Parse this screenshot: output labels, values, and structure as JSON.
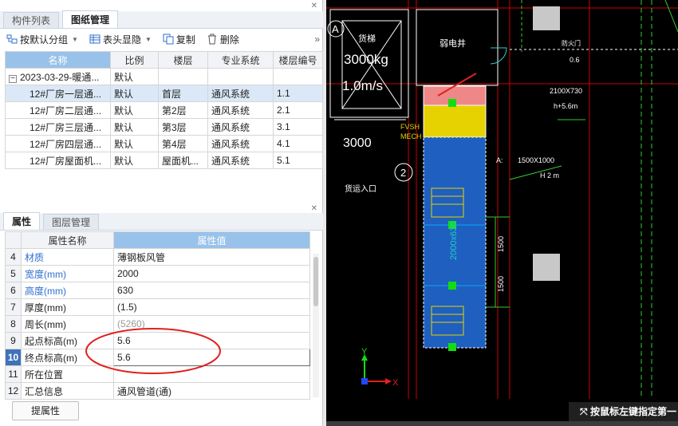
{
  "top_tabs": [
    "构件列表",
    "图纸管理"
  ],
  "toolbar": {
    "group_label": "按默认分组",
    "header_label": "表头显隐",
    "copy_label": "复制",
    "delete_label": "删除",
    "more": "»"
  },
  "drawings_table": {
    "headers": [
      "名称",
      "比例",
      "楼层",
      "专业系统",
      "楼层编号"
    ],
    "group": {
      "expander": "−",
      "name": "2023-03-29-暖通...",
      "scale": "默认"
    },
    "rows": [
      {
        "name": "12#厂房一层通...",
        "scale": "默认",
        "floor": "首层",
        "system": "通风系统",
        "code": "1.1"
      },
      {
        "name": "12#厂房二层通...",
        "scale": "默认",
        "floor": "第2层",
        "system": "通风系统",
        "code": "2.1"
      },
      {
        "name": "12#厂房三层通...",
        "scale": "默认",
        "floor": "第3层",
        "system": "通风系统",
        "code": "3.1"
      },
      {
        "name": "12#厂房四层通...",
        "scale": "默认",
        "floor": "第4层",
        "system": "通风系统",
        "code": "4.1"
      },
      {
        "name": "12#厂房屋面机...",
        "scale": "默认",
        "floor": "屋面机...",
        "system": "通风系统",
        "code": "5.1"
      }
    ]
  },
  "props_tabs": [
    "属性",
    "图层管理"
  ],
  "props_table": {
    "headers": [
      "属性名称",
      "属性值"
    ],
    "rows": [
      {
        "num": "4",
        "name": "材质",
        "value": "薄钢板风管",
        "blue": true
      },
      {
        "num": "5",
        "name": "宽度(mm)",
        "value": "2000",
        "blue": true
      },
      {
        "num": "6",
        "name": "高度(mm)",
        "value": "630",
        "blue": true
      },
      {
        "num": "7",
        "name": "厚度(mm)",
        "value": "(1.5)",
        "blue": false
      },
      {
        "num": "8",
        "name": "周长(mm)",
        "value": "(5260)",
        "blue": false,
        "gray": true
      },
      {
        "num": "9",
        "name": "起点标高(m)",
        "value": "5.6",
        "blue": false
      },
      {
        "num": "10",
        "name": "终点标高(m)",
        "value": "5.6",
        "blue": false,
        "active": true
      },
      {
        "num": "11",
        "name": "所在位置",
        "value": "",
        "blue": false
      },
      {
        "num": "12",
        "name": "汇总信息",
        "value": "通风管道(通)",
        "blue": false
      }
    ]
  },
  "extract_button": "提属性",
  "cad": {
    "label_a": "A",
    "lift_text": "货梯",
    "load": "3000kg",
    "speed": "1.0m/s",
    "room_text": "弱电井",
    "dim_3000": "3000",
    "grid_2": "2",
    "entrance": "货运入口",
    "fvsh": "FVSH",
    "mech": "MECH",
    "size_2100": "2100X730",
    "elev": "h+5.6m",
    "size_a": "A:",
    "size_1500": "1500X1000",
    "h2": "H 2 m",
    "duct_label": "2000x630",
    "dim_1500a": "1500",
    "dim_1500b": "1500",
    "door_text": "防火门",
    "door_code": "0.6",
    "axis_y": "Y",
    "axis_x": "X",
    "status": "按鼠标左键指定第一"
  },
  "colors": {
    "accent": "#3f72ba",
    "header_hl": "#99c2ea",
    "duct_blue": "#1f5fbf",
    "annotation_red": "#e02020"
  }
}
